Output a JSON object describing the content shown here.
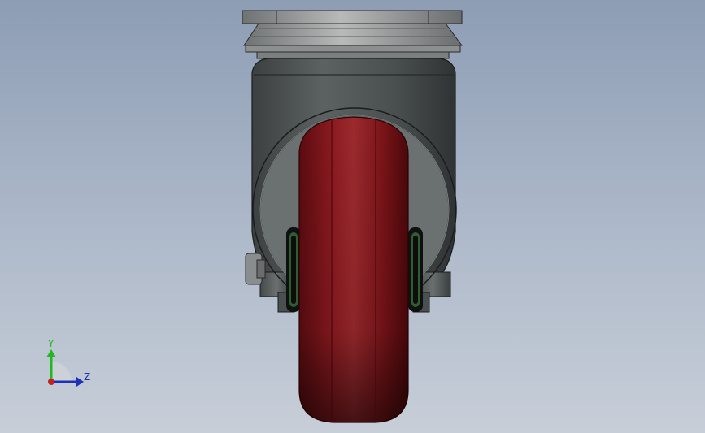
{
  "scene": {
    "object": "caster-wheel-front-view",
    "background_top": "#8d9db4",
    "background_bottom": "#c7ced8",
    "body_color": "#505555",
    "wheel_color": "#8a1a1e",
    "axle_ring_color": "#1a1a1a",
    "axle_seal_color": "#2f5d2f",
    "plate_color": "#9a9c9c"
  },
  "triad": {
    "y_label": "Y",
    "z_label": "Z",
    "y_color": "#1fb81f",
    "z_color": "#1f2fb8",
    "x_color": "#c81f1f"
  }
}
